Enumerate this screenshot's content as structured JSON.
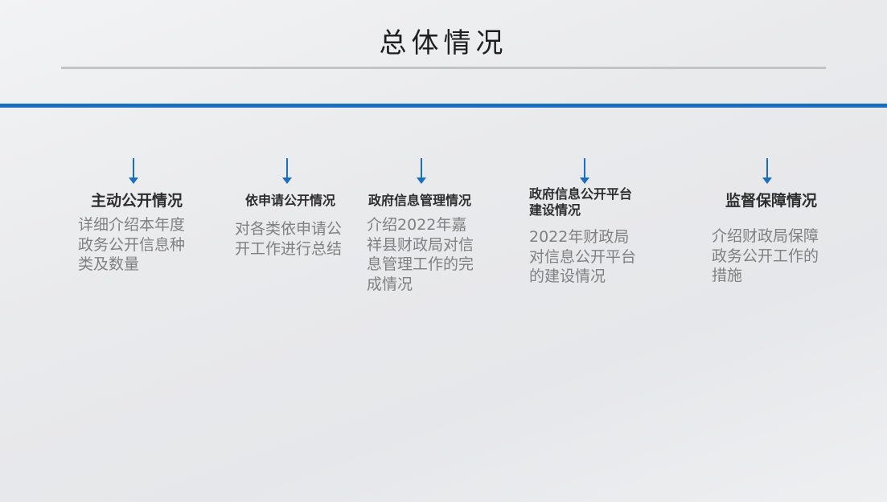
{
  "slide": {
    "title": "总体情况",
    "accent_color": "#1a6ebf",
    "items": [
      {
        "heading": "主动公开情况",
        "desc": "详细介绍本年度政务公开信息种类及数量"
      },
      {
        "heading": "依申请公开情况",
        "desc": "对各类依申请公开工作进行总结"
      },
      {
        "heading": "政府信息管理情况",
        "desc": "介绍2022年嘉祥县财政局对信息管理工作的完成情况"
      },
      {
        "heading": "政府信息公开平台建设情况",
        "desc": "2022年财政局对信息公开平台的建设情况"
      },
      {
        "heading": "监督保障情况",
        "desc": "介绍财政局保障政务公开工作的措施"
      }
    ]
  }
}
